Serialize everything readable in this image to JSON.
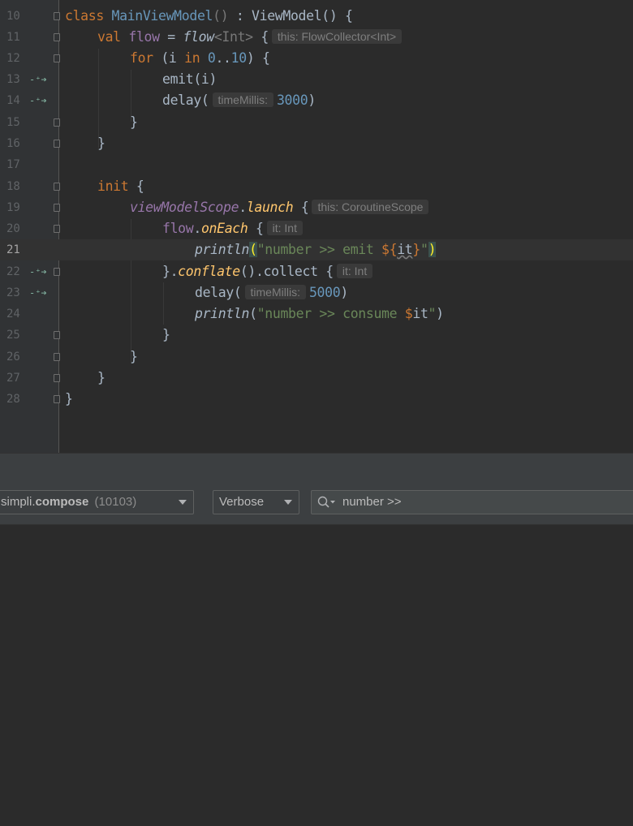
{
  "editor": {
    "lines": [
      {
        "n": "10"
      },
      {
        "n": "11"
      },
      {
        "n": "12"
      },
      {
        "n": "13"
      },
      {
        "n": "14"
      },
      {
        "n": "15"
      },
      {
        "n": "16"
      },
      {
        "n": "17"
      },
      {
        "n": "18"
      },
      {
        "n": "19"
      },
      {
        "n": "20"
      },
      {
        "n": "21"
      },
      {
        "n": "22"
      },
      {
        "n": "23"
      },
      {
        "n": "24"
      },
      {
        "n": "25"
      },
      {
        "n": "26"
      },
      {
        "n": "27"
      },
      {
        "n": "28"
      }
    ],
    "code": {
      "l10_kw": "class",
      "l10_name": "MainViewModel",
      "l10_parens": "()",
      "l10_rest": " : ViewModel() {",
      "l11_kw": "val",
      "l11_prop": "flow",
      "l11_eq": " = ",
      "l11_fn": "flow",
      "l11_gen": "<Int>",
      "l11_brace": " {",
      "l11_hint": "this: FlowCollector<Int>",
      "l12_kw": "for",
      "l12_a": " (i ",
      "l12_in": "in",
      "l12_space": " ",
      "l12_n0": "0",
      "l12_dots": "..",
      "l12_n10": "10",
      "l12_b": ") {",
      "l13": "emit(i)",
      "l14_a": "delay(",
      "l14_hint": "timeMillis:",
      "l14_num": "3000",
      "l14_b": ")",
      "l15": "}",
      "l16": "}",
      "l18_kw": "init",
      "l18_b": " {",
      "l19_fn": "viewModelScope",
      "l19_dot": ".",
      "l19_launch": "launch",
      "l19_b": " {",
      "l19_hint": "this: CoroutineScope",
      "l20_prop": "flow",
      "l20_dot": ".",
      "l20_fn": "onEach",
      "l20_b": " {",
      "l20_hint": "it: Int",
      "l21_fn": "println",
      "l21_open": "(",
      "l21_str": "\"number >> emit ",
      "l21_tmpl_open": "${",
      "l21_it": "it",
      "l21_tmpl_close": "}",
      "l21_quote": "\"",
      "l21_close": ")",
      "l22_a": "}.",
      "l22_fn": "conflate",
      "l22_b": "().collect {",
      "l22_hint": "it: Int",
      "l23_a": "delay(",
      "l23_hint": "timeMillis:",
      "l23_num": "5000",
      "l23_b": ")",
      "l24_fn": "println",
      "l24_open": "(",
      "l24_str": "\"number >> consume ",
      "l24_tmpl": "$",
      "l24_it": "it",
      "l24_quote": "\"",
      "l24_close": ")",
      "l25": "}",
      "l26": "}",
      "l27": "}",
      "l28": "}"
    }
  },
  "toolbar": {
    "process_prefix": "simpli.",
    "process_bold": "compose",
    "process_pid": "(10103)",
    "level": "Verbose",
    "search_value": "number >>"
  },
  "icons": {
    "recursive_call": "recursive-call-icon",
    "fold": "fold-icon",
    "search": "search-icon",
    "dropdown": "chevron-down-icon"
  }
}
